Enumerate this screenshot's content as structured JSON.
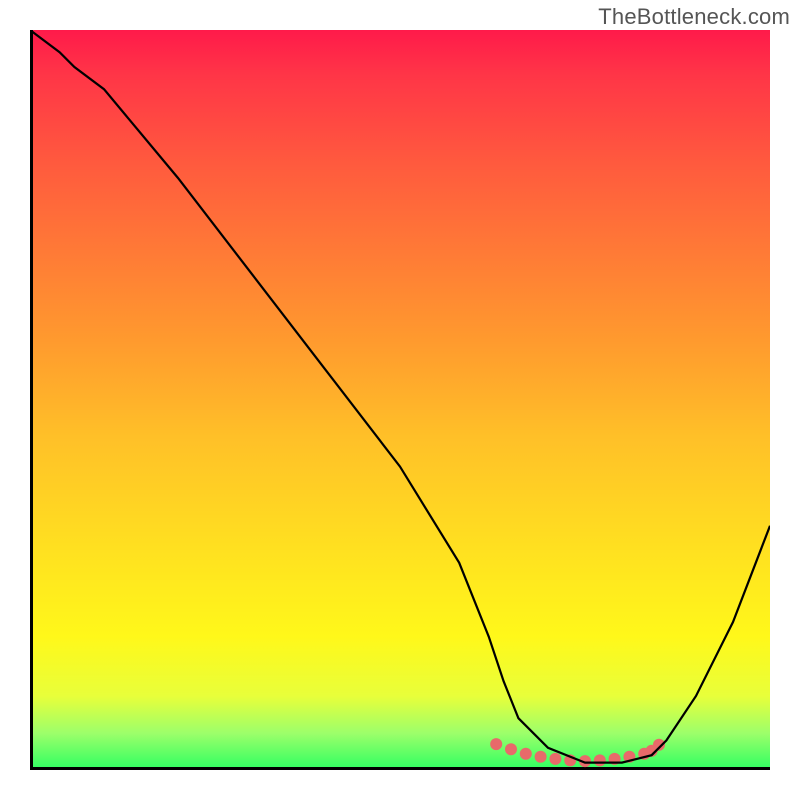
{
  "watermark": "TheBottleneck.com",
  "chart_data": {
    "type": "line",
    "title": "",
    "xlabel": "",
    "ylabel": "",
    "xlim": [
      0,
      100
    ],
    "ylim": [
      0,
      100
    ],
    "series": [
      {
        "name": "curve",
        "x": [
          0,
          4,
          6,
          10,
          20,
          30,
          40,
          50,
          58,
          62,
          64,
          66,
          70,
          75,
          80,
          84,
          86,
          90,
          95,
          100
        ],
        "y": [
          100,
          97,
          95,
          92,
          80,
          67,
          54,
          41,
          28,
          18,
          12,
          7,
          3,
          1,
          1,
          2,
          4,
          10,
          20,
          33
        ]
      },
      {
        "name": "highlight-dots",
        "x": [
          63,
          65,
          67,
          69,
          71,
          73,
          75,
          77,
          79,
          81,
          83,
          84,
          85
        ],
        "y": [
          3.5,
          2.8,
          2.2,
          1.8,
          1.5,
          1.3,
          1.2,
          1.3,
          1.5,
          1.8,
          2.2,
          2.6,
          3.4
        ]
      }
    ],
    "style": {
      "curve_color": "#000000",
      "curve_width": 2.2,
      "dot_color": "#e86a6a",
      "dot_radius": 6
    },
    "gradient_stops": [
      {
        "pct": 0,
        "color": "#ff1a4a"
      },
      {
        "pct": 6,
        "color": "#ff3547"
      },
      {
        "pct": 18,
        "color": "#ff5a3e"
      },
      {
        "pct": 30,
        "color": "#ff7a36"
      },
      {
        "pct": 42,
        "color": "#ff9a2e"
      },
      {
        "pct": 55,
        "color": "#ffc028"
      },
      {
        "pct": 70,
        "color": "#ffe020"
      },
      {
        "pct": 82,
        "color": "#fff81a"
      },
      {
        "pct": 90,
        "color": "#e8ff3a"
      },
      {
        "pct": 95,
        "color": "#9dff6a"
      },
      {
        "pct": 100,
        "color": "#2dff62"
      }
    ]
  }
}
